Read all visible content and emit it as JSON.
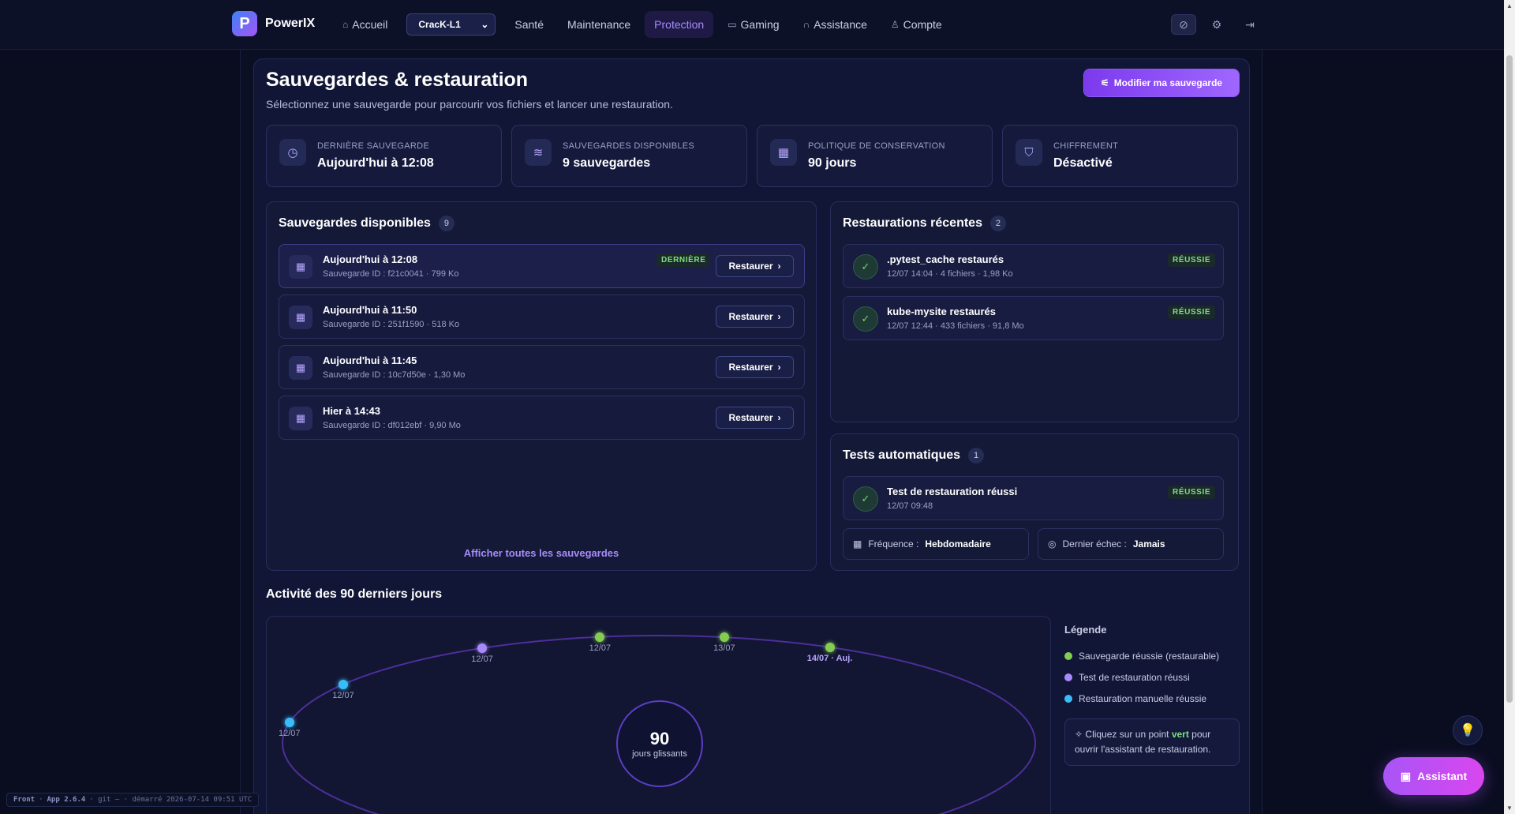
{
  "brand": {
    "name": "PowerIX",
    "logo_letter": "P"
  },
  "nav": {
    "home": "Accueil",
    "machine": "CracK-L1",
    "health": "Santé",
    "maintenance": "Maintenance",
    "protection": "Protection",
    "gaming": "Gaming",
    "support": "Assistance",
    "account": "Compte"
  },
  "page": {
    "title": "Sauvegardes & restauration",
    "subtitle": "Sélectionnez une sauvegarde pour parcourir vos fichiers et lancer une restauration.",
    "primary_button": "Modifier ma sauvegarde"
  },
  "stats": [
    {
      "label": "DERNIÈRE SAUVEGARDE",
      "value": "Aujourd'hui à 12:08",
      "icon": "calendar-clock-icon"
    },
    {
      "label": "SAUVEGARDES DISPONIBLES",
      "value": "9 sauvegardes",
      "icon": "layers-icon"
    },
    {
      "label": "POLITIQUE DE CONSERVATION",
      "value": "90 jours",
      "icon": "calendar-icon"
    },
    {
      "label": "CHIFFREMENT",
      "value": "Désactivé",
      "icon": "shield-icon"
    }
  ],
  "backups": {
    "title": "Sauvegardes disponibles",
    "count": "9",
    "latest_badge": "DERNIÈRE",
    "restore_label": "Restaurer",
    "show_all": "Afficher toutes les sauvegardes",
    "items": [
      {
        "title": "Aujourd'hui à 12:08",
        "sub": "Sauvegarde ID : f21c0041 · 799 Ko"
      },
      {
        "title": "Aujourd'hui à 11:50",
        "sub": "Sauvegarde ID : 251f1590 · 518 Ko"
      },
      {
        "title": "Aujourd'hui à 11:45",
        "sub": "Sauvegarde ID : 10c7d50e · 1,30 Mo"
      },
      {
        "title": "Hier à 14:43",
        "sub": "Sauvegarde ID : df012ebf · 9,90 Mo"
      }
    ]
  },
  "restores": {
    "title": "Restaurations récentes",
    "count": "2",
    "items": [
      {
        "title": ".pytest_cache restaurés",
        "sub": "12/07 14:04 · 4 fichiers · 1,98 Ko",
        "badge": "RÉUSSIE"
      },
      {
        "title": "kube-mysite restaurés",
        "sub": "12/07 12:44 · 433 fichiers · 91,8 Mo",
        "badge": "RÉUSSIE"
      }
    ]
  },
  "tests": {
    "title": "Tests automatiques",
    "count": "1",
    "item": {
      "title": "Test de restauration réussi",
      "sub": "12/07 09:48",
      "badge": "RÉUSSIE"
    },
    "frequency_label": "Fréquence :",
    "frequency_value": "Hebdomadaire",
    "last_fail_label": "Dernier échec :",
    "last_fail_value": "Jamais"
  },
  "activity": {
    "title": "Activité des 90 derniers jours",
    "center_value": "90",
    "center_label": "jours glissants",
    "points": [
      {
        "label": "12/07",
        "type": "manual"
      },
      {
        "label": "12/07",
        "type": "manual"
      },
      {
        "label": "12/07",
        "type": "test"
      },
      {
        "label": "12/07",
        "type": "backup"
      },
      {
        "label": "13/07",
        "type": "backup"
      },
      {
        "label": "14/07 · Auj.",
        "type": "backup"
      }
    ]
  },
  "legend": {
    "title": "Légende",
    "items": [
      {
        "label": "Sauvegarde réussie (restaurable)",
        "color": "#84cc52"
      },
      {
        "label": "Test de restauration réussi",
        "color": "#a78bfa"
      },
      {
        "label": "Restauration manuelle réussie",
        "color": "#38bdf8"
      }
    ],
    "hint_pre": "Cliquez sur un point",
    "hint_green": "vert",
    "hint_post": "pour ouvrir l'assistant de restauration."
  },
  "footer": {
    "front": "Front",
    "app": "App 2.6.4",
    "git": "· git — · démarré 2026-07-14 09:51 UTC"
  },
  "assistant": {
    "label": "Assistant"
  },
  "colors": {
    "accent": "#8b5cf6",
    "success": "#7ee07a",
    "bg": "#0b0f24"
  }
}
